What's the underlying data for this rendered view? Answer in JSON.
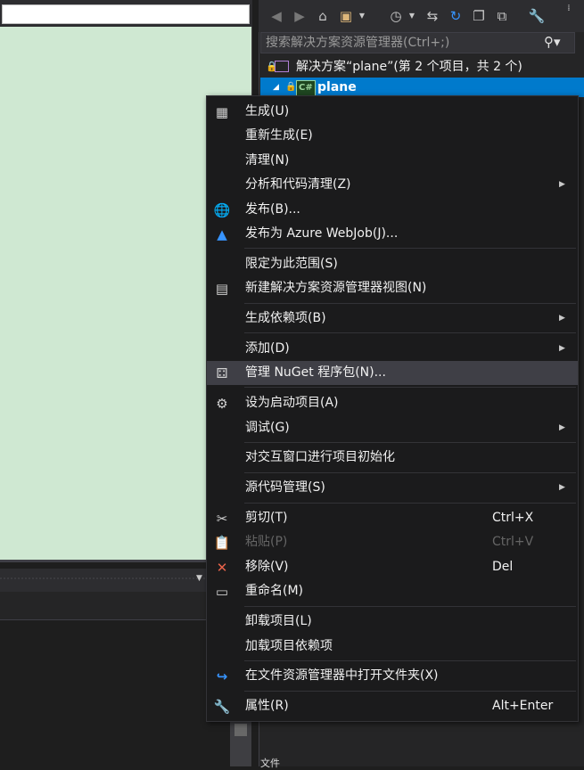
{
  "solution_explorer": {
    "search_placeholder": "搜索解决方案资源管理器(Ctrl+;)",
    "solution_label": "解决方案“plane”(第 2 个项目，共 2 个)",
    "project_label": "plane",
    "project_lang_badge": "C#",
    "bottom_text": "文件"
  },
  "context_menu": {
    "build": "生成(U)",
    "rebuild": "重新生成(E)",
    "clean": "清理(N)",
    "analyze": "分析和代码清理(Z)",
    "publish": "发布(B)...",
    "publish_azure": "发布为 Azure WebJob(J)...",
    "scope_to_this": "限定为此范围(S)",
    "new_se_view": "新建解决方案资源管理器视图(N)",
    "build_dependencies": "生成依赖项(B)",
    "add": "添加(D)",
    "manage_nuget": "管理 NuGet 程序包(N)...",
    "set_startup": "设为启动项目(A)",
    "debug": "调试(G)",
    "init_interactive": "对交互窗口进行项目初始化",
    "source_control": "源代码管理(S)",
    "cut": "剪切(T)",
    "cut_shortcut": "Ctrl+X",
    "paste": "粘贴(P)",
    "paste_shortcut": "Ctrl+V",
    "remove": "移除(V)",
    "remove_shortcut": "Del",
    "rename": "重命名(M)",
    "unload": "卸载项目(L)",
    "load_deps": "加载项目依赖项",
    "open_in_explorer": "在文件资源管理器中打开文件夹(X)",
    "properties": "属性(R)",
    "properties_shortcut": "Alt+Enter"
  },
  "colors": {
    "designer_bg": "#cfe8d2",
    "selection": "#007acc",
    "menu_bg": "#1b1b1c",
    "menu_hover": "#3f3f46"
  }
}
